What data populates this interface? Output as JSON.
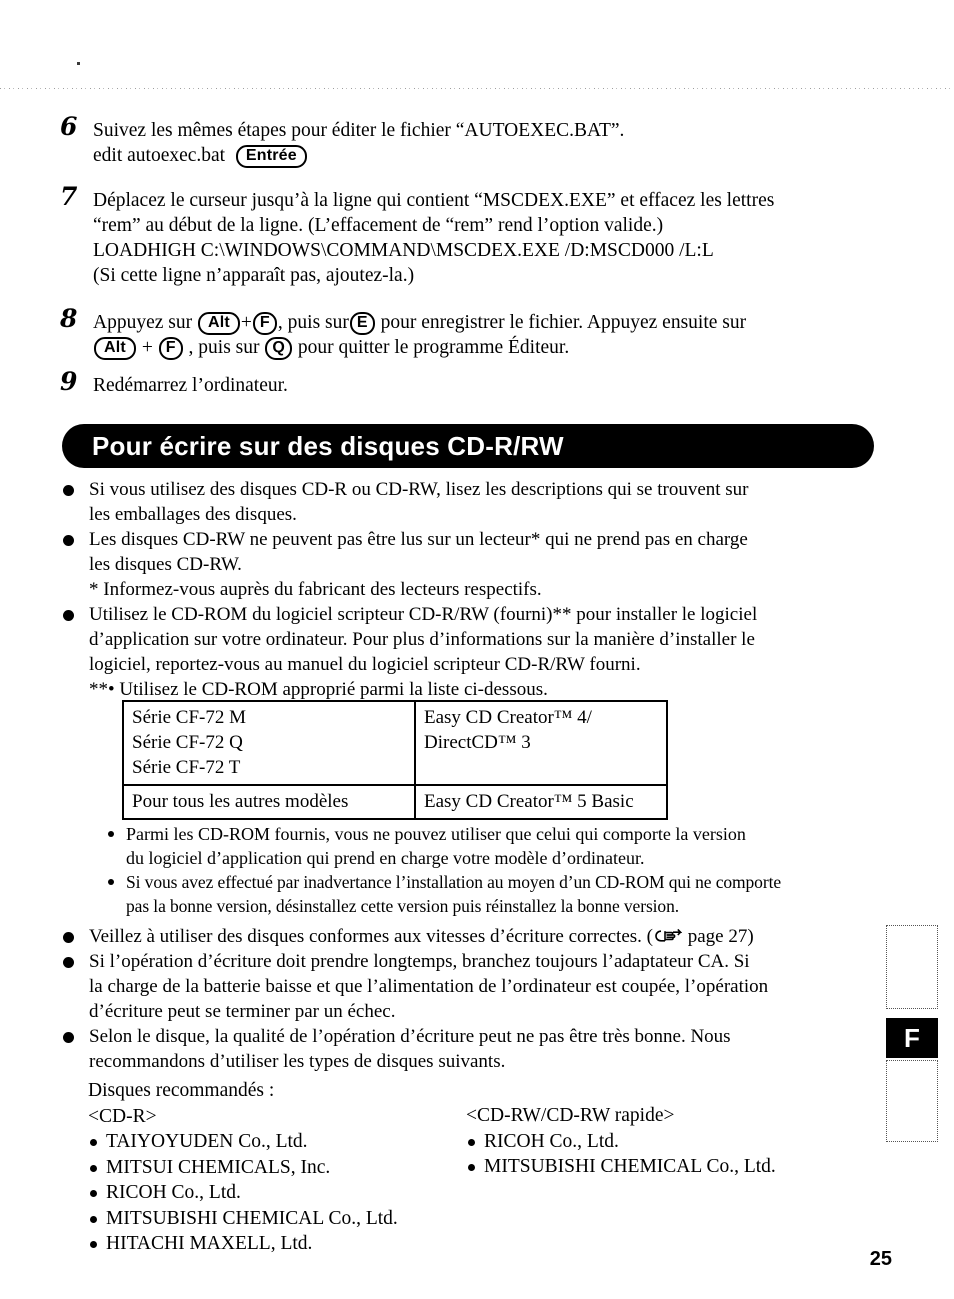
{
  "page": {
    "number": "25",
    "thumb_index_letter": "F"
  },
  "steps": [
    {
      "number": "6",
      "lines": [
        {
          "type": "text",
          "text": "Suivez les mêmes étapes pour éditer le fichier “AUTOEXEC.BAT”."
        },
        {
          "type": "keyline",
          "before": "edit autoexec.bat",
          "key": "Entrée",
          "after": ""
        }
      ]
    },
    {
      "number": "7",
      "lines": [
        {
          "type": "text",
          "text": "Déplacez le curseur jusqu’à la ligne qui contient “MSCDEX.EXE” et effacez les lettres"
        },
        {
          "type": "text",
          "text": "“rem” au début de la ligne.  (L’effacement de “rem” rend l’option valide.)"
        },
        {
          "type": "text",
          "text": "LOADHIGH  C:\\WINDOWS\\COMMAND\\MSCDEX.EXE /D:MSCD000 /L:L"
        },
        {
          "type": "text",
          "text": "(Si cette ligne n’apparaît pas, ajoutez-la.)"
        }
      ]
    },
    {
      "number": "8",
      "lines": [
        {
          "type": "keys",
          "segments": [
            {
              "t": "text",
              "v": "Appuyez sur "
            },
            {
              "t": "key",
              "v": "Alt"
            },
            {
              "t": "text",
              "v": "+"
            },
            {
              "t": "key",
              "v": "F"
            },
            {
              "t": "text",
              "v": ", puis sur"
            },
            {
              "t": "key",
              "v": "E"
            },
            {
              "t": "text",
              "v": " pour enregistrer le fichier. Appuyez ensuite sur"
            }
          ]
        },
        {
          "type": "keys",
          "segments": [
            {
              "t": "key",
              "v": "Alt"
            },
            {
              "t": "text",
              "v": " + "
            },
            {
              "t": "key",
              "v": "F"
            },
            {
              "t": "text",
              "v": " , puis sur "
            },
            {
              "t": "key",
              "v": "Q"
            },
            {
              "t": "text",
              "v": " pour quitter le programme Éditeur."
            }
          ]
        }
      ]
    },
    {
      "number": "9",
      "lines": [
        {
          "type": "text",
          "text": "Redémarrez l’ordinateur."
        }
      ]
    }
  ],
  "section": {
    "title": "Pour écrire sur des disques CD-R/RW",
    "bullets": [
      {
        "lines": [
          "Si vous utilisez des disques CD-R ou CD-RW, lisez les descriptions qui se trouvent sur",
          "les emballages des disques."
        ]
      },
      {
        "lines": [
          "Les disques CD-RW ne peuvent pas être lus sur un lecteur* qui ne prend pas en charge",
          "les disques CD-RW."
        ],
        "note": "* Informez-vous auprès du fabricant des lecteurs respectifs."
      },
      {
        "lines": [
          "Utilisez le CD-ROM du logiciel scripteur CD-R/RW (fourni)** pour installer le logiciel",
          "d’application sur votre ordinateur. Pour plus d’informations sur la manière d’installer le",
          "logiciel, reportez-vous au manuel du logiciel scripteur CD-R/RW fourni."
        ],
        "note": "**• Utilisez le CD-ROM approprié parmi la liste ci-dessous."
      }
    ],
    "table": {
      "rows": [
        {
          "left": [
            "Série CF-72 M",
            "Série CF-72 Q",
            "Série CF-72 T"
          ],
          "right": [
            "Easy CD Creator™ 4/",
            "DirectCD™ 3"
          ]
        },
        {
          "left": [
            "Pour tous les autres modèles"
          ],
          "right": [
            "Easy CD Creator™ 5 Basic"
          ]
        }
      ]
    },
    "subbullets": [
      {
        "lines": [
          "Parmi les CD-ROM fournis, vous ne pouvez utiliser que celui qui comporte la version",
          "du logiciel d’application qui prend en charge votre modèle d’ordinateur."
        ]
      },
      {
        "tight": true,
        "lines": [
          "Si vous avez effectué par inadvertance l’installation au moyen d’un CD-ROM qui ne comporte",
          "pas la bonne version, désinstallez cette version puis réinstallez la bonne version."
        ]
      }
    ],
    "bullets2": [
      {
        "reference": true,
        "prefix": "Veillez à utiliser des disques conformes aux vitesses d’écriture correctes. (",
        "ref_text": " page 27)",
        "icon": "pointing-hand-icon"
      },
      {
        "lines": [
          "Si l’opération d’écriture doit prendre longtemps, branchez toujours l’adaptateur CA. Si",
          "la charge de la batterie baisse et que l’alimentation de l’ordinateur est coupée, l’opération",
          "d’écriture peut se terminer par un échec."
        ]
      },
      {
        "lines": [
          "Selon le disque, la qualité de l’opération d’écriture peut ne pas être très bonne. Nous",
          "recommandons d’utiliser les types de disques suivants."
        ]
      }
    ],
    "recommended": {
      "heading": "Disques recommandés :",
      "left": {
        "label": "<CD-R>",
        "items": [
          "TAIYOYUDEN Co., Ltd.",
          "MITSUI CHEMICALS, Inc.",
          "RICOH Co., Ltd.",
          "MITSUBISHI CHEMICAL Co., Ltd.",
          "HITACHI MAXELL, Ltd."
        ]
      },
      "right": {
        "label": "<CD-RW/CD-RW rapide>",
        "items": [
          "RICOH Co., Ltd.",
          "MITSUBISHI CHEMICAL Co., Ltd."
        ]
      }
    }
  }
}
